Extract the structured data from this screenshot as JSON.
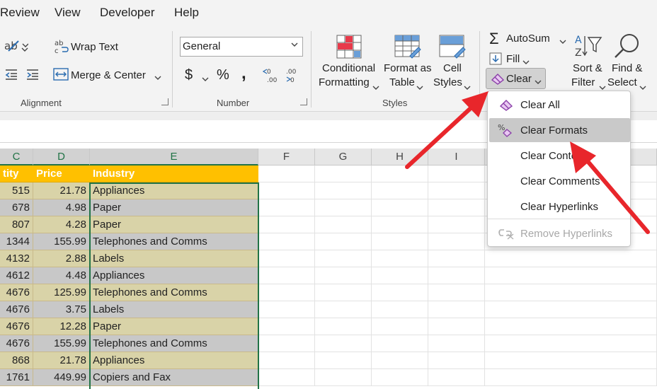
{
  "menu": [
    "Review",
    "View",
    "Developer",
    "Help"
  ],
  "ribbon": {
    "alignment": {
      "wrap_text": "Wrap Text",
      "merge_center": "Merge & Center",
      "label": "Alignment"
    },
    "number": {
      "format_value": "General",
      "currency": "$",
      "percent": "%",
      "comma": ",",
      "label": "Number"
    },
    "styles": {
      "conditional_formatting": [
        "Conditional",
        "Formatting"
      ],
      "format_as_table": [
        "Format as",
        "Table"
      ],
      "cell_styles": [
        "Cell",
        "Styles"
      ],
      "label": "Styles"
    },
    "editing": {
      "autosum": "AutoSum",
      "fill": "Fill",
      "clear": "Clear",
      "sort_filter": [
        "Sort &",
        "Filter"
      ],
      "find_select": [
        "Find &",
        "Select"
      ]
    }
  },
  "clear_menu": {
    "items": [
      {
        "label": "Clear All",
        "icon": "eraser-icon",
        "state": "normal"
      },
      {
        "label": "Clear Formats",
        "icon": "clear-formats-icon",
        "state": "highlighted"
      },
      {
        "label": "Clear Contents",
        "icon": "",
        "state": "normal"
      },
      {
        "label": "Clear Comments",
        "icon": "",
        "state": "normal"
      },
      {
        "label": "Clear Hyperlinks",
        "icon": "",
        "state": "normal"
      },
      {
        "label": "Remove Hyperlinks",
        "icon": "unlink-icon",
        "state": "disabled"
      }
    ]
  },
  "sheet": {
    "columns": [
      "C",
      "D",
      "E",
      "F",
      "G",
      "H",
      "I"
    ],
    "header_row": {
      "c": "tity",
      "d": "Price",
      "e": "Industry"
    },
    "rows": [
      {
        "c": "515",
        "d": "21.78",
        "e": "Appliances"
      },
      {
        "c": "678",
        "d": "4.98",
        "e": "Paper"
      },
      {
        "c": "807",
        "d": "4.28",
        "e": "Paper"
      },
      {
        "c": "1344",
        "d": "155.99",
        "e": "Telephones and Comms"
      },
      {
        "c": "4132",
        "d": "2.88",
        "e": "Labels"
      },
      {
        "c": "4612",
        "d": "4.48",
        "e": "Appliances"
      },
      {
        "c": "4676",
        "d": "125.99",
        "e": "Telephones and Comms"
      },
      {
        "c": "4676",
        "d": "3.75",
        "e": "Labels"
      },
      {
        "c": "4676",
        "d": "12.28",
        "e": "Paper"
      },
      {
        "c": "4676",
        "d": "155.99",
        "e": "Telephones and Comms"
      },
      {
        "c": "868",
        "d": "21.78",
        "e": "Appliances"
      },
      {
        "c": "1761",
        "d": "449.99",
        "e": "Copiers and Fax"
      }
    ]
  },
  "colors": {
    "accent_green": "#217346",
    "header_orange": "#ffc000",
    "band_tan": "#d9d3a8",
    "band_gray": "#c8c8c8",
    "arrow_red": "#e8262b"
  }
}
